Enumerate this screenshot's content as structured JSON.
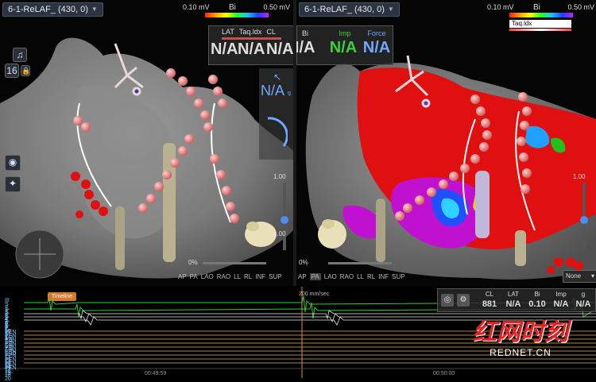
{
  "left_view": {
    "title": "6-1-ReLAF_ (430, 0)",
    "colorbar_min": "0.10 mV",
    "colorbar_max": "0.50 mV",
    "colorbar_label": "Bi",
    "legend_items": [
      "LAT",
      "Taq.ldx",
      "CL"
    ],
    "value_headers": [
      "",
      "",
      "",
      "Bi",
      "Imp",
      "Force"
    ],
    "values": [
      "N/A",
      "N/A",
      "N/A",
      "N/A",
      "N/A",
      "N/A"
    ],
    "side_value": "N/A",
    "side_value_sub": "g",
    "counter": "16",
    "zoom_top": "1.00",
    "zoom_bottom": "1.00",
    "opacity": "0%",
    "view_buttons": [
      "AP",
      "PA",
      "LAO",
      "RAO",
      "LL",
      "RL",
      "INF",
      "SUP"
    ]
  },
  "right_view": {
    "title": "6-1-ReLAF_ (430, 0)",
    "colorbar_min": "0.10 mV",
    "colorbar_max": "0.50 mV",
    "colorbar_label": "Bi",
    "legend_items": [
      "Taq.ldx"
    ],
    "zoom_top": "1.00",
    "opacity": "0%",
    "view_buttons": [
      "AP",
      "PA",
      "LAO",
      "RAO",
      "LL",
      "RL",
      "INF",
      "SUP"
    ],
    "dropdown": "None"
  },
  "timeline": {
    "tab": "Timeline",
    "speed": "200 mm/sec",
    "time_left": "00:49:59",
    "time_right": "00:50:00",
    "channels": [
      "III",
      "S 1-2",
      "S 3-4",
      "S 5-6",
      "S 7-8",
      "S 9-10",
      "P 1-2",
      "P 3-4",
      "PEN 1-2",
      "PEN 3-4",
      "PEN 5-6",
      "PEN 7-8",
      "PEN 9-10",
      "PEN 11-12",
      "PEN 13-14",
      "PEN 15-16",
      "PEN 17-18",
      "PEN 19-20"
    ],
    "readout_headers": [
      "CL",
      "LAT",
      "Bi",
      "Imp",
      "g"
    ],
    "readout_values": [
      "881",
      "N/A",
      "0.10",
      "N/A",
      "N/A"
    ]
  },
  "watermark": {
    "logo_text": "红网时刻",
    "url": "REDNET.CN"
  },
  "colors": {
    "bi_red": "#e01010",
    "bi_purple": "#c010d0",
    "signal_green": "#30d030",
    "label_blue": "#6fa8ff",
    "imp_green": "#3ccf3c"
  }
}
